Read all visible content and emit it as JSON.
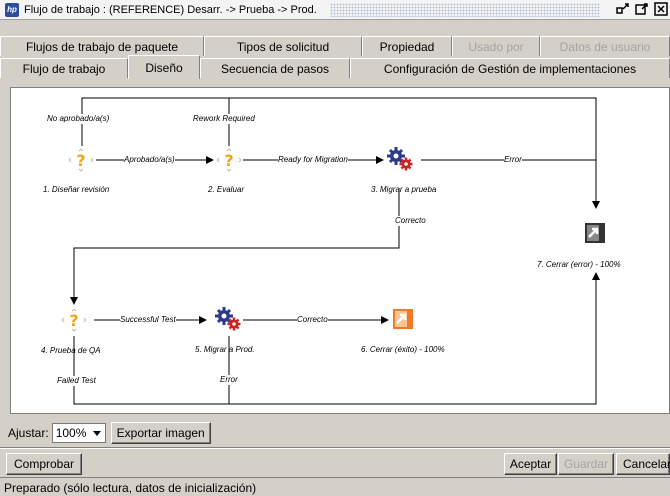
{
  "window": {
    "title": "Flujo de trabajo : (REFERENCE) Desarr. -> Prueba -> Prod.",
    "app_icon_text": "hp"
  },
  "tabs": {
    "row1": [
      {
        "label": "Flujos de trabajo de paquete",
        "state": "normal"
      },
      {
        "label": "Tipos de solicitud",
        "state": "normal"
      },
      {
        "label": "Propiedad",
        "state": "normal"
      },
      {
        "label": "Usado por",
        "state": "disabled"
      },
      {
        "label": "Datos de usuario",
        "state": "disabled"
      }
    ],
    "row2": [
      {
        "label": "Flujo de trabajo",
        "state": "normal"
      },
      {
        "label": "Diseño",
        "state": "active"
      },
      {
        "label": "Secuencia de pasos",
        "state": "normal"
      },
      {
        "label": "Configuración de Gestión de implementaciones",
        "state": "normal"
      }
    ]
  },
  "diagram": {
    "nodes": {
      "n1": {
        "name": "1. Diseñar revisión",
        "icon": "decision-question-icon"
      },
      "n2": {
        "name": "2. Evaluar",
        "icon": "decision-question-icon"
      },
      "n3": {
        "name": "3. Migrar a prueba",
        "icon": "gears-execution-icon"
      },
      "n4": {
        "name": "4. Prueba de QA",
        "icon": "decision-question-icon"
      },
      "n5": {
        "name": "5. Migrar a Prod.",
        "icon": "gears-execution-icon"
      },
      "n6": {
        "name": "6. Cerrar (éxito) - 100%",
        "icon": "close-success-icon"
      },
      "n7": {
        "name": "7. Cerrar (error) - 100%",
        "icon": "close-error-icon"
      }
    },
    "transitions": {
      "t_no_aprobado": "No aprobado/a(s)",
      "t_rework": "Rework Required",
      "t_aprobado": "Aprobado/a(s)",
      "t_ready": "Ready for Migration",
      "t_error1": "Error",
      "t_correcto1": "Correcto",
      "t_successful": "Successful Test",
      "t_correcto2": "Correcto",
      "t_failed": "Failed Test",
      "t_error2": "Error"
    }
  },
  "zoom": {
    "label": "Ajustar:",
    "value": "100%"
  },
  "buttons": {
    "export": "Exportar imagen",
    "check": "Comprobar",
    "accept": "Aceptar",
    "save": "Guardar",
    "cancel": "Cancelar"
  },
  "status": "Preparado (sólo lectura, datos de inicialización)",
  "colors": {
    "close_success": "#f07a28",
    "gear_blue": "#2a3a8c",
    "gear_red": "#d02020",
    "question": "#f4a418"
  }
}
